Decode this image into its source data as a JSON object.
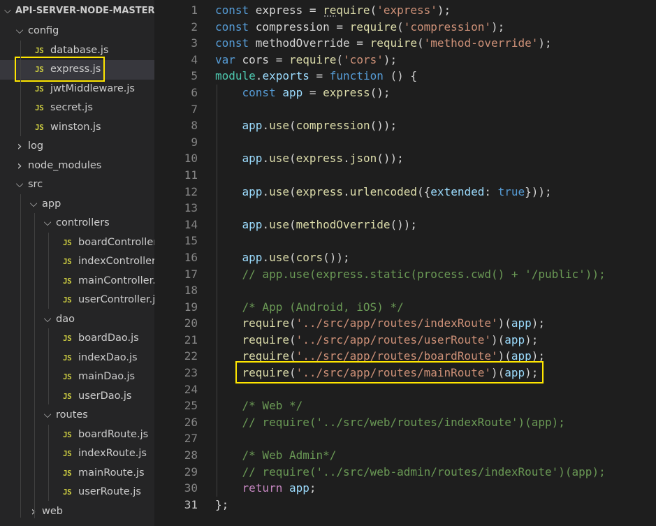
{
  "explorer": {
    "root_label": "API-SERVER-NODE-MASTER",
    "js_icon": "JS",
    "items": [
      {
        "type": "folder",
        "label": "config",
        "depth": 0,
        "open": true
      },
      {
        "type": "file",
        "label": "database.js",
        "depth": 1
      },
      {
        "type": "file",
        "label": "express.js",
        "depth": 1,
        "selected": true,
        "highlighted": true
      },
      {
        "type": "file",
        "label": "jwtMiddleware.js",
        "depth": 1
      },
      {
        "type": "file",
        "label": "secret.js",
        "depth": 1
      },
      {
        "type": "file",
        "label": "winston.js",
        "depth": 1
      },
      {
        "type": "folder",
        "label": "log",
        "depth": 0,
        "open": false
      },
      {
        "type": "folder",
        "label": "node_modules",
        "depth": 0,
        "open": false
      },
      {
        "type": "folder",
        "label": "src",
        "depth": 0,
        "open": true
      },
      {
        "type": "folder",
        "label": "app",
        "depth": 1,
        "open": true
      },
      {
        "type": "folder",
        "label": "controllers",
        "depth": 2,
        "open": true
      },
      {
        "type": "file",
        "label": "boardController.js",
        "depth": 3
      },
      {
        "type": "file",
        "label": "indexController.js",
        "depth": 3
      },
      {
        "type": "file",
        "label": "mainController.js",
        "depth": 3
      },
      {
        "type": "file",
        "label": "userController.js",
        "depth": 3
      },
      {
        "type": "folder",
        "label": "dao",
        "depth": 2,
        "open": true
      },
      {
        "type": "file",
        "label": "boardDao.js",
        "depth": 3
      },
      {
        "type": "file",
        "label": "indexDao.js",
        "depth": 3
      },
      {
        "type": "file",
        "label": "mainDao.js",
        "depth": 3
      },
      {
        "type": "file",
        "label": "userDao.js",
        "depth": 3
      },
      {
        "type": "folder",
        "label": "routes",
        "depth": 2,
        "open": true
      },
      {
        "type": "file",
        "label": "boardRoute.js",
        "depth": 3
      },
      {
        "type": "file",
        "label": "indexRoute.js",
        "depth": 3
      },
      {
        "type": "file",
        "label": "mainRoute.js",
        "depth": 3
      },
      {
        "type": "file",
        "label": "userRoute.js",
        "depth": 3
      },
      {
        "type": "folder",
        "label": "web",
        "depth": 1,
        "open": false
      }
    ]
  },
  "editor": {
    "active_line": 31,
    "highlighted_line": 23,
    "lines": [
      [
        [
          "kw",
          "const "
        ],
        [
          "p",
          "express = "
        ],
        [
          "fn",
          "require"
        ],
        [
          "p",
          "("
        ],
        [
          "str",
          "'express'"
        ],
        [
          "p",
          ");"
        ]
      ],
      [
        [
          "kw",
          "const "
        ],
        [
          "p",
          "compression = "
        ],
        [
          "fn",
          "require"
        ],
        [
          "p",
          "("
        ],
        [
          "str",
          "'compression'"
        ],
        [
          "p",
          ");"
        ]
      ],
      [
        [
          "kw",
          "const "
        ],
        [
          "p",
          "methodOverride = "
        ],
        [
          "fn",
          "require"
        ],
        [
          "p",
          "("
        ],
        [
          "str",
          "'method-override'"
        ],
        [
          "p",
          ");"
        ]
      ],
      [
        [
          "kw",
          "var "
        ],
        [
          "p",
          "cors = "
        ],
        [
          "fn",
          "require"
        ],
        [
          "p",
          "("
        ],
        [
          "str",
          "'cors'"
        ],
        [
          "p",
          ");"
        ]
      ],
      [
        [
          "cls",
          "module"
        ],
        [
          "p",
          "."
        ],
        [
          "var",
          "exports"
        ],
        [
          "p",
          " = "
        ],
        [
          "kw",
          "function"
        ],
        [
          "p",
          " () {"
        ]
      ],
      [
        [
          "p",
          "    "
        ],
        [
          "kw",
          "const "
        ],
        [
          "var",
          "app"
        ],
        [
          "p",
          " = "
        ],
        [
          "fn",
          "express"
        ],
        [
          "p",
          "();"
        ]
      ],
      [],
      [
        [
          "p",
          "    "
        ],
        [
          "var",
          "app"
        ],
        [
          "p",
          "."
        ],
        [
          "fn",
          "use"
        ],
        [
          "p",
          "("
        ],
        [
          "fn",
          "compression"
        ],
        [
          "p",
          "());"
        ]
      ],
      [],
      [
        [
          "p",
          "    "
        ],
        [
          "var",
          "app"
        ],
        [
          "p",
          "."
        ],
        [
          "fn",
          "use"
        ],
        [
          "p",
          "("
        ],
        [
          "fn",
          "express"
        ],
        [
          "p",
          "."
        ],
        [
          "fn",
          "json"
        ],
        [
          "p",
          "());"
        ]
      ],
      [],
      [
        [
          "p",
          "    "
        ],
        [
          "var",
          "app"
        ],
        [
          "p",
          "."
        ],
        [
          "fn",
          "use"
        ],
        [
          "p",
          "("
        ],
        [
          "fn",
          "express"
        ],
        [
          "p",
          "."
        ],
        [
          "fn",
          "urlencoded"
        ],
        [
          "p",
          "({"
        ],
        [
          "var",
          "extended"
        ],
        [
          "p",
          ": "
        ],
        [
          "kw",
          "true"
        ],
        [
          "p",
          "}));"
        ]
      ],
      [],
      [
        [
          "p",
          "    "
        ],
        [
          "var",
          "app"
        ],
        [
          "p",
          "."
        ],
        [
          "fn",
          "use"
        ],
        [
          "p",
          "("
        ],
        [
          "fn",
          "methodOverride"
        ],
        [
          "p",
          "());"
        ]
      ],
      [],
      [
        [
          "p",
          "    "
        ],
        [
          "var",
          "app"
        ],
        [
          "p",
          "."
        ],
        [
          "fn",
          "use"
        ],
        [
          "p",
          "("
        ],
        [
          "fn",
          "cors"
        ],
        [
          "p",
          "());"
        ]
      ],
      [
        [
          "p",
          "    "
        ],
        [
          "cm",
          "// app.use(express.static(process.cwd() + '/public'));"
        ]
      ],
      [],
      [
        [
          "p",
          "    "
        ],
        [
          "cm",
          "/* App (Android, iOS) */"
        ]
      ],
      [
        [
          "p",
          "    "
        ],
        [
          "fn",
          "require"
        ],
        [
          "p",
          "("
        ],
        [
          "str",
          "'../src/app/routes/indexRoute'"
        ],
        [
          "p",
          ")("
        ],
        [
          "var",
          "app"
        ],
        [
          "p",
          ");"
        ]
      ],
      [
        [
          "p",
          "    "
        ],
        [
          "fn",
          "require"
        ],
        [
          "p",
          "("
        ],
        [
          "str",
          "'../src/app/routes/userRoute'"
        ],
        [
          "p",
          ")("
        ],
        [
          "var",
          "app"
        ],
        [
          "p",
          ");"
        ]
      ],
      [
        [
          "p",
          "    "
        ],
        [
          "fn",
          "require"
        ],
        [
          "p",
          "("
        ],
        [
          "str",
          "'../src/app/routes/boardRoute'"
        ],
        [
          "p",
          ")("
        ],
        [
          "var",
          "app"
        ],
        [
          "p",
          ");"
        ]
      ],
      [
        [
          "p",
          "    "
        ],
        [
          "fn",
          "require"
        ],
        [
          "p",
          "("
        ],
        [
          "str",
          "'../src/app/routes/mainRoute'"
        ],
        [
          "p",
          ")("
        ],
        [
          "var",
          "app"
        ],
        [
          "p",
          ");"
        ]
      ],
      [],
      [
        [
          "p",
          "    "
        ],
        [
          "cm",
          "/* Web */"
        ]
      ],
      [
        [
          "p",
          "    "
        ],
        [
          "cm",
          "// require('../src/web/routes/indexRoute')(app);"
        ]
      ],
      [],
      [
        [
          "p",
          "    "
        ],
        [
          "cm",
          "/* Web Admin*/"
        ]
      ],
      [
        [
          "p",
          "    "
        ],
        [
          "cm",
          "// require('../src/web-admin/routes/indexRoute')(app);"
        ]
      ],
      [
        [
          "p",
          "    "
        ],
        [
          "ctl",
          "return "
        ],
        [
          "var",
          "app"
        ],
        [
          "p",
          ";"
        ]
      ],
      [
        [
          "p",
          "};"
        ]
      ]
    ]
  },
  "colors": {
    "highlight_box": "#ffe600",
    "js_icon": "#cbcb41",
    "selected_row": "#37373d"
  }
}
